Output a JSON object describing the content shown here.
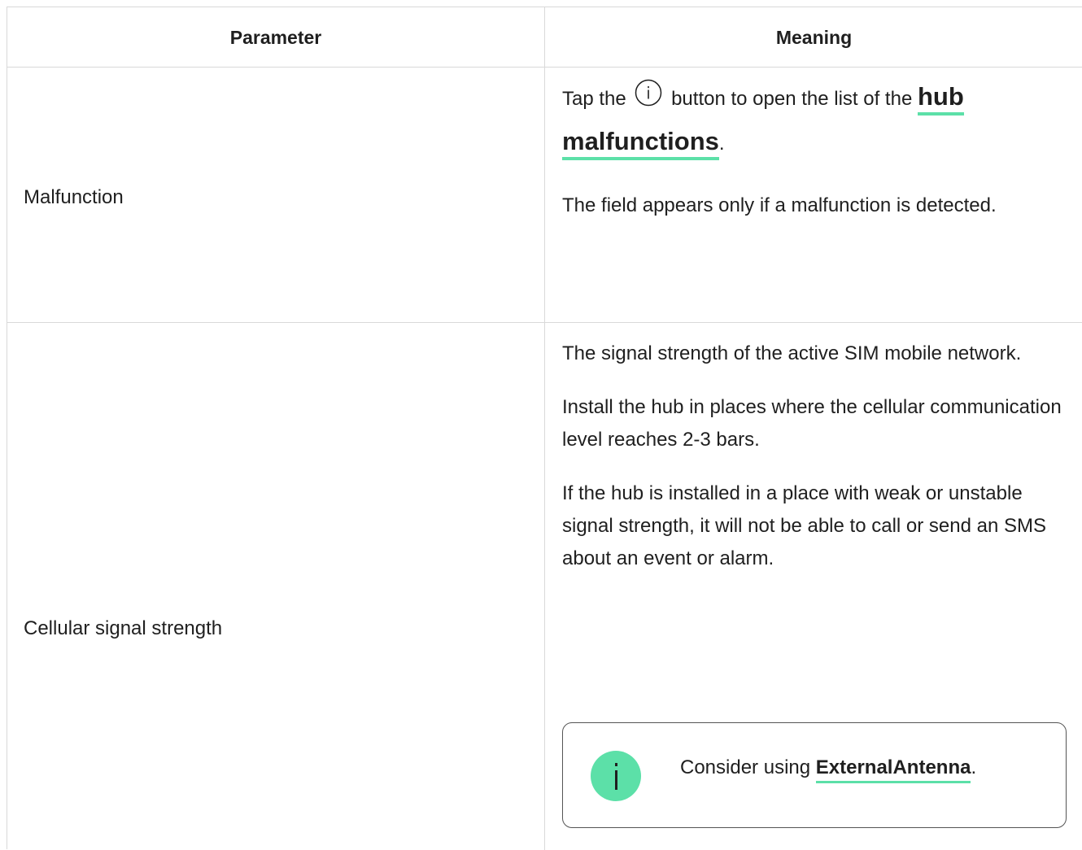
{
  "table": {
    "headers": {
      "parameter": "Parameter",
      "meaning": "Meaning"
    },
    "rows": [
      {
        "parameter": "Malfunction",
        "meaning": {
          "line1_before_icon": "Tap the",
          "icon": "info-circle-icon",
          "line1_after_icon": "button to open the list of the",
          "link_word1": "hub",
          "link_word2": "malfunctions",
          "link_suffix": ".",
          "paragraph2": "The field appears only if a malfunction is detected."
        }
      },
      {
        "parameter": "Cellular signal strength",
        "meaning": {
          "paragraph1": "The signal strength of the active SIM mobile network.",
          "paragraph2": "Install the hub in places where the cellular communication level reaches 2-3 bars.",
          "paragraph3": "If the hub is installed in a place with weak or unstable signal strength, it will not be able to call or send an SMS about an event or alarm.",
          "note": {
            "icon": "info-icon",
            "text_before_link": "Consider using",
            "link": "ExternalAntenna",
            "text_after_link": "."
          }
        }
      }
    ]
  },
  "colors": {
    "accent": "#5ce0a8",
    "border": "#d9d9d9",
    "text": "#1f1f1f"
  }
}
